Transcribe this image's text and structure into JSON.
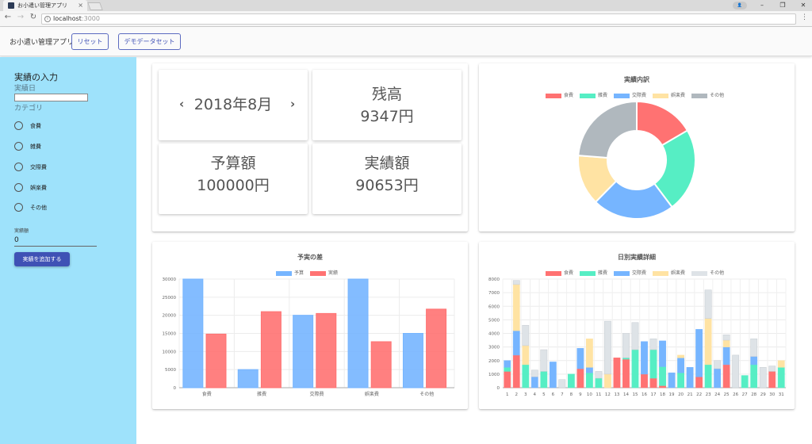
{
  "browser": {
    "tab_title": "お小遣い管理アプリ",
    "url_host": "localhost",
    "url_port": ":3000"
  },
  "appbar": {
    "title": "お小遣い管理アプリ",
    "reset_label": "リセット",
    "demo_label": "デモデータセット"
  },
  "sidebar": {
    "heading": "実績の入力",
    "date_label": "実績日",
    "category_label": "カテゴリ",
    "categories": [
      "食費",
      "雑費",
      "交際費",
      "娯楽費",
      "その他"
    ],
    "amount_label": "実績額",
    "amount_value": "0",
    "add_button": "実績を追加する"
  },
  "summary": {
    "month_prev": "‹",
    "month": "2018年8月",
    "month_next": "›",
    "balance_label": "残高",
    "balance_value": "9347円",
    "budget_label": "予算額",
    "budget_value": "100000円",
    "actual_label": "実績額",
    "actual_value": "90653円"
  },
  "colors": {
    "red": "#ff7272",
    "green": "#56eec4",
    "blue": "#76b5ff",
    "yellow": "#ffe3a3",
    "gray": "#b0b8be",
    "lightgray": "#dee3e7"
  },
  "chart_data": [
    {
      "type": "pie",
      "title": "実績内訳",
      "categories": [
        "食費",
        "雑費",
        "交際費",
        "娯楽費",
        "その他"
      ],
      "values": [
        15000,
        21000,
        20500,
        12600,
        21500
      ],
      "colors": [
        "#ff7272",
        "#56eec4",
        "#76b5ff",
        "#ffe3a3",
        "#b0b8be"
      ],
      "legend": "top"
    },
    {
      "type": "bar",
      "title": "予実の差",
      "categories": [
        "食費",
        "雑費",
        "交際費",
        "娯楽費",
        "その他"
      ],
      "series": [
        {
          "name": "予算",
          "values": [
            30000,
            5000,
            20000,
            30000,
            15000
          ],
          "color": "#76b5ff"
        },
        {
          "name": "実績",
          "values": [
            14800,
            21000,
            20500,
            12700,
            21700
          ],
          "color": "#ff7272"
        }
      ],
      "ylim": [
        0,
        30000
      ],
      "yticks": [
        0,
        5000,
        10000,
        15000,
        20000,
        25000,
        30000
      ],
      "legend": "top",
      "grid": true
    },
    {
      "type": "bar",
      "stacked": true,
      "title": "日別実績詳細",
      "categories": [
        "1",
        "2",
        "3",
        "4",
        "5",
        "6",
        "7",
        "8",
        "9",
        "10",
        "11",
        "12",
        "13",
        "14",
        "15",
        "16",
        "17",
        "18",
        "19",
        "20",
        "21",
        "22",
        "23",
        "24",
        "25",
        "26",
        "27",
        "28",
        "29",
        "30",
        "31"
      ],
      "series": [
        {
          "name": "食費",
          "color": "#ff7272",
          "values": [
            1200,
            2400,
            0,
            0,
            0,
            0,
            0,
            0,
            1400,
            0,
            0,
            0,
            2200,
            2100,
            0,
            1000,
            700,
            150,
            0,
            0,
            0,
            800,
            0,
            0,
            1700,
            0,
            0,
            0,
            0,
            1200,
            0
          ]
        },
        {
          "name": "雑費",
          "color": "#56eec4",
          "values": [
            300,
            0,
            1700,
            0,
            1200,
            0,
            0,
            1000,
            0,
            1100,
            700,
            0,
            0,
            100,
            2800,
            0,
            2100,
            1400,
            0,
            1100,
            0,
            0,
            1700,
            0,
            0,
            0,
            900,
            1700,
            0,
            0,
            1500
          ]
        },
        {
          "name": "交際費",
          "color": "#76b5ff",
          "values": [
            500,
            1800,
            0,
            800,
            0,
            1900,
            0,
            0,
            1500,
            400,
            0,
            0,
            0,
            0,
            0,
            2400,
            0,
            1900,
            1100,
            1100,
            1500,
            3500,
            0,
            1400,
            1300,
            0,
            0,
            600,
            0,
            0,
            0
          ]
        },
        {
          "name": "娯楽費",
          "color": "#ffe3a3",
          "values": [
            0,
            3400,
            1400,
            0,
            0,
            0,
            0,
            0,
            0,
            2100,
            0,
            1000,
            0,
            0,
            0,
            0,
            0,
            0,
            0,
            200,
            0,
            0,
            3400,
            0,
            500,
            0,
            0,
            0,
            0,
            0,
            500
          ]
        },
        {
          "name": "その他",
          "color": "#dee3e7",
          "values": [
            0,
            300,
            1500,
            500,
            1600,
            0,
            600,
            0,
            0,
            0,
            500,
            3900,
            0,
            1800,
            2000,
            0,
            800,
            0,
            0,
            0,
            0,
            0,
            2100,
            600,
            400,
            2400,
            0,
            1300,
            1500,
            400,
            0
          ]
        }
      ],
      "ylim": [
        0,
        8000
      ],
      "yticks": [
        0,
        1000,
        2000,
        3000,
        4000,
        5000,
        6000,
        7000,
        8000
      ],
      "legend": "top",
      "grid": true
    }
  ]
}
